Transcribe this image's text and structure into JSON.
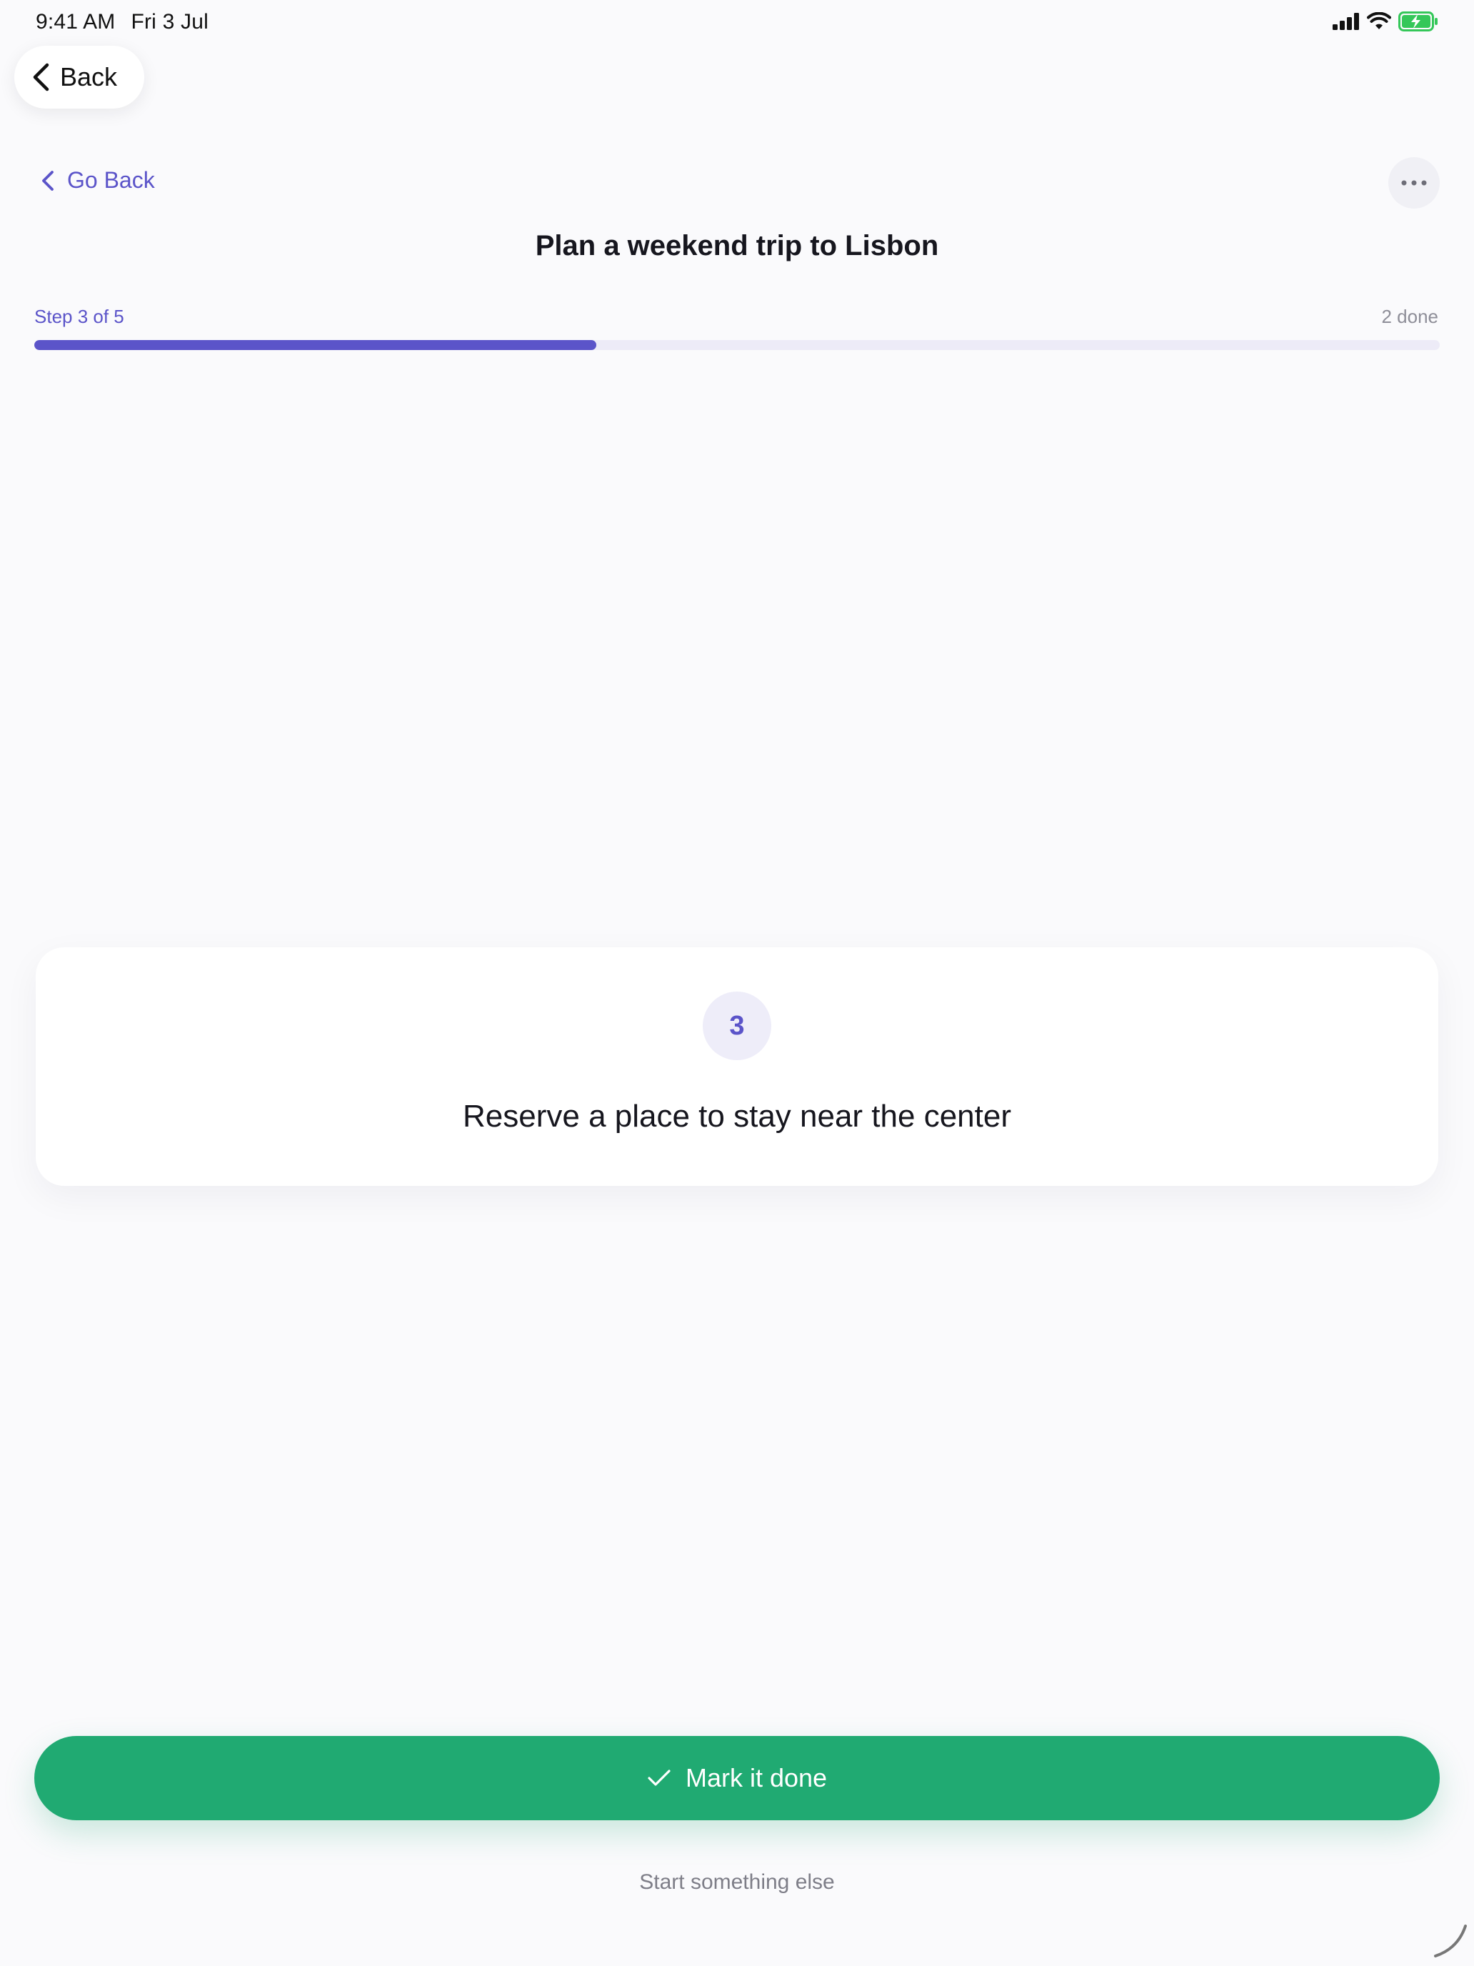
{
  "status_bar": {
    "time": "9:41 AM",
    "date": "Fri 3 Jul",
    "icons": [
      "cellular-signal-icon",
      "wifi-icon",
      "battery-charging-icon"
    ]
  },
  "nav": {
    "back_label": "Back",
    "go_back_label": "Go Back",
    "more_icon": "ellipsis-icon"
  },
  "task": {
    "title": "Plan a weekend trip to Lisbon"
  },
  "progress": {
    "step_label": "Step 3 of 5",
    "done_label": "2 done",
    "completed": 2,
    "total": 5
  },
  "current_step": {
    "number": "3",
    "text": "Reserve a place to stay near the center"
  },
  "actions": {
    "primary_label": "Mark it done",
    "secondary_label": "Start something else"
  },
  "colors": {
    "accent": "#5B54C9",
    "success": "#20AA72",
    "background": "#FAFAFC"
  }
}
